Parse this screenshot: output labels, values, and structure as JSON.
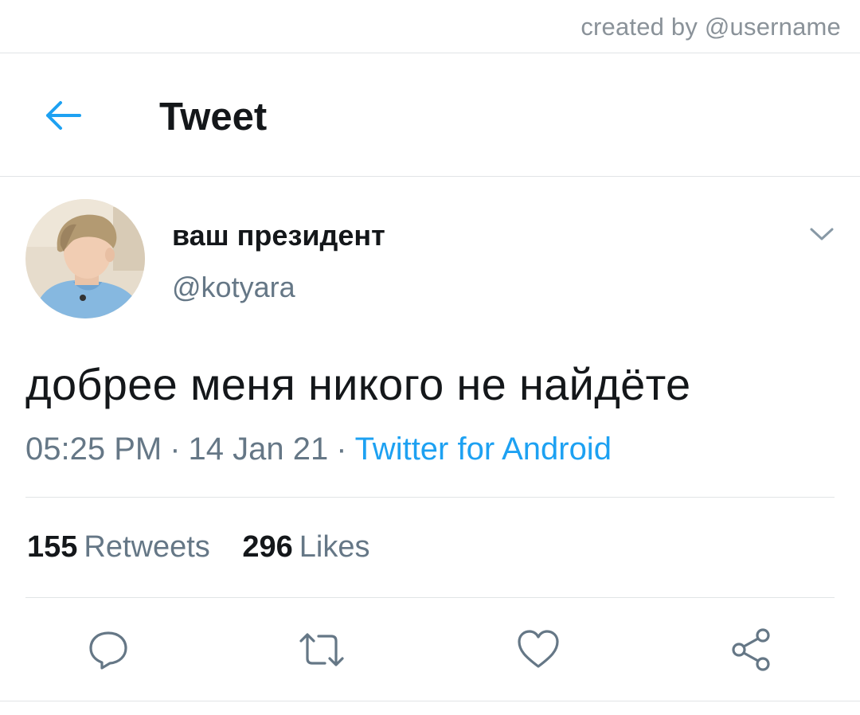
{
  "credit": {
    "text": "created by @username"
  },
  "header": {
    "title": "Tweet",
    "back_icon": "arrow-left-icon"
  },
  "tweet": {
    "display_name": "ваш президент",
    "handle": "@kotyara",
    "text": "добрее меня никого не найдёте",
    "time": "05:25 PM",
    "date": "14 Jan 21",
    "separator": "·",
    "source": "Twitter for Android"
  },
  "stats": {
    "retweets_count": "155",
    "retweets_label": "Retweets",
    "likes_count": "296",
    "likes_label": "Likes"
  },
  "actions": {
    "reply_icon": "reply-icon",
    "retweet_icon": "retweet-icon",
    "like_icon": "heart-icon",
    "share_icon": "share-icon"
  },
  "colors": {
    "accent": "#1da1f2",
    "text_primary": "#14171a",
    "text_secondary": "#657786",
    "divider": "#e1e4e6"
  }
}
